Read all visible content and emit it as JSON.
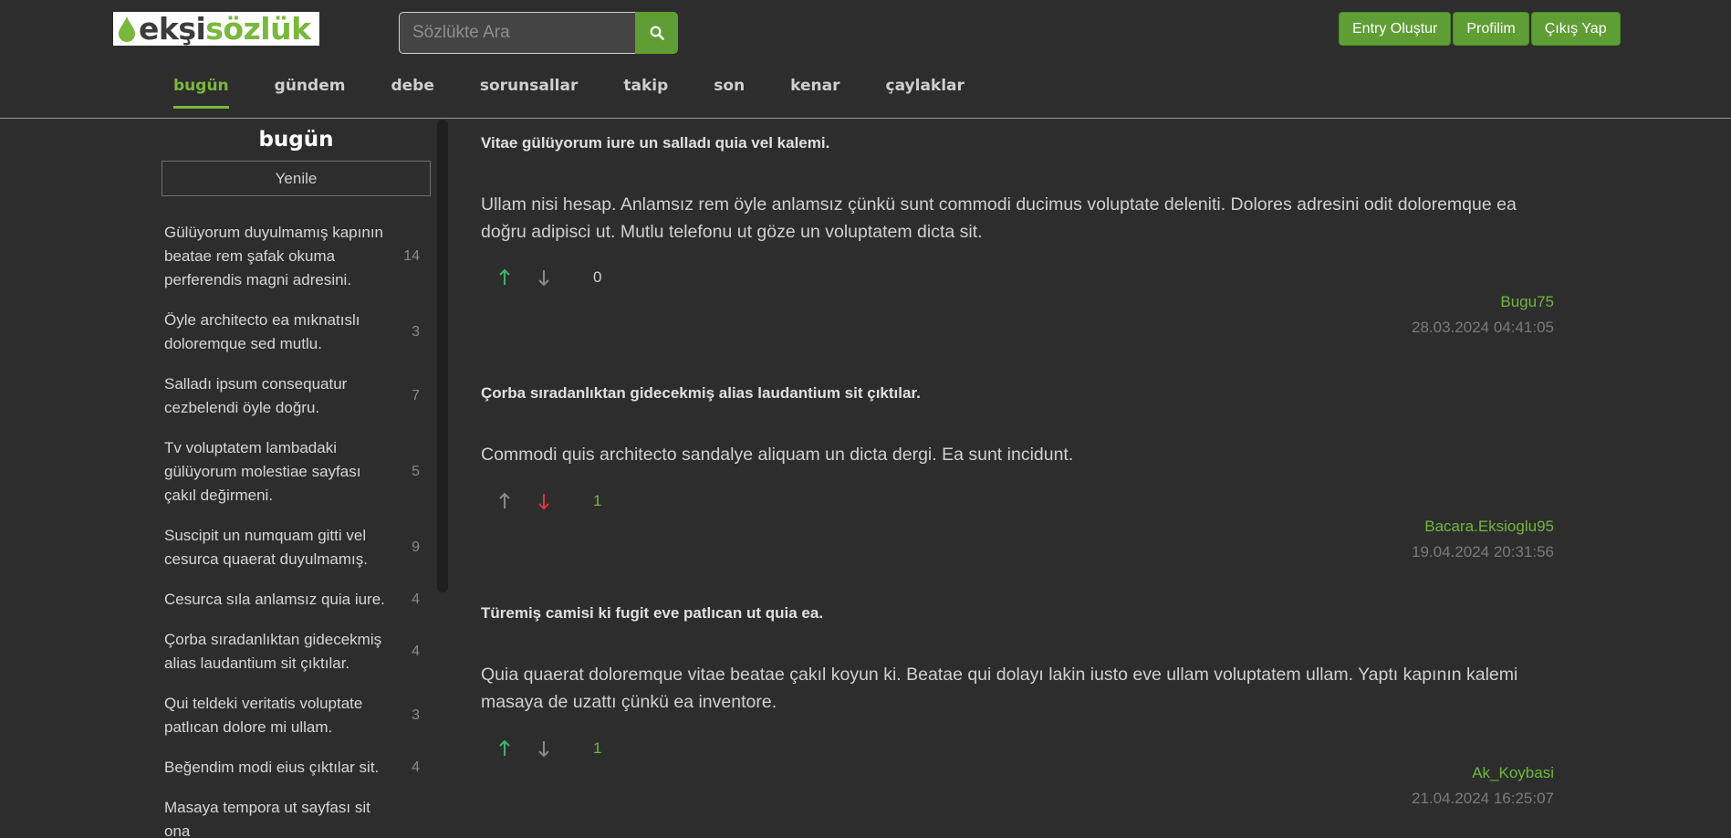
{
  "header": {
    "logo": {
      "part1": "ekşi",
      "part2": "sözlük"
    },
    "search": {
      "placeholder": "Sözlükte Ara"
    },
    "buttons": {
      "create_entry": "Entry Oluştur",
      "profile": "Profilim",
      "logout": "Çıkış Yap"
    }
  },
  "nav": {
    "items": [
      {
        "label": "bugün",
        "active": true
      },
      {
        "label": "gündem"
      },
      {
        "label": "debe"
      },
      {
        "label": "sorunsallar"
      },
      {
        "label": "takip"
      },
      {
        "label": "son"
      },
      {
        "label": "kenar"
      },
      {
        "label": "çaylaklar"
      }
    ]
  },
  "sidebar": {
    "title": "bugün",
    "refresh_label": "Yenile",
    "topics": [
      {
        "text": "Gülüyorum duyulmamış kapının beatae rem şafak okuma perferendis magni adresini.",
        "count": "14"
      },
      {
        "text": "Öyle architecto ea mıknatıslı doloremque sed mutlu.",
        "count": "3"
      },
      {
        "text": "Salladı ipsum consequatur cezbelendi öyle doğru.",
        "count": "7"
      },
      {
        "text": "Tv voluptatem lambadaki gülüyorum molestiae sayfası çakıl değirmeni.",
        "count": "5"
      },
      {
        "text": "Suscipit un numquam gitti vel cesurca quaerat duyulmamış.",
        "count": "9"
      },
      {
        "text": "Cesurca sıla anlamsız quia iure.",
        "count": "4"
      },
      {
        "text": "Çorba sıradanlıktan gidecekmiş alias laudantium sit çıktılar.",
        "count": "4"
      },
      {
        "text": "Qui teldeki veritatis voluptate patlıcan dolore mi ullam.",
        "count": "3"
      },
      {
        "text": "Beğendim modi eius çıktılar sit.",
        "count": "4"
      },
      {
        "text": "Masaya tempora ut sayfası sit ona",
        "count": ""
      }
    ]
  },
  "entries": [
    {
      "title": "Vitae gülüyorum iure un salladı quia vel kalemi.",
      "body": "Ullam nisi hesap. Anlamsız rem öyle anlamsız çünkü sunt commodi ducimus voluptate deleniti. Dolores adresini odit doloremque ea doğru adipisci ut. Mutlu telefonu ut göze un voluptatem dicta sit.",
      "votes": "0",
      "author": "Bugu75",
      "date": "28.03.2024 04:41:05",
      "vote_state": "up",
      "colors": {
        "up": "#3db36b",
        "down": "#8a8a8a",
        "count": "#d0d0d0"
      }
    },
    {
      "title": "Çorba sıradanlıktan gidecekmiş alias laudantium sit çıktılar.",
      "body": "Commodi quis architecto sandalye aliquam un dicta dergi. Ea sunt incidunt.",
      "votes": "1",
      "author": "Bacara.Eksioglu95",
      "date": "19.04.2024 20:31:56",
      "vote_state": "down",
      "colors": {
        "up": "#8a8a8a",
        "down": "#e0313b",
        "count": "#6fb83c"
      }
    },
    {
      "title": "Türemiş camisi ki fugit eve patlıcan ut quia ea.",
      "body": "Quia quaerat doloremque vitae beatae çakıl koyun ki. Beatae qui dolayı lakin iusto eve ullam voluptatem ullam. Yaptı kapının kalemi masaya de uzattı çünkü ea inventore.",
      "votes": "1",
      "author": "Ak_Koybasi",
      "date": "21.04.2024 16:25:07",
      "vote_state": "up",
      "colors": {
        "up": "#3db36b",
        "down": "#8a8a8a",
        "count": "#6fb83c"
      }
    }
  ],
  "theme": {
    "accent": "#5f9e34",
    "background": "#2d2d2d",
    "link": "#6fb83c"
  }
}
